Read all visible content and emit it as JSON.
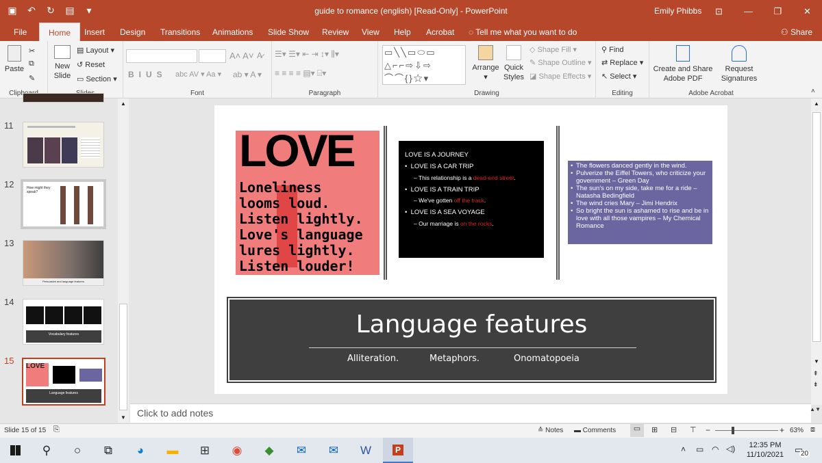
{
  "window": {
    "title": "guide to romance (english) [Read-Only]  -  PowerPoint",
    "user": "Emily Phibbs"
  },
  "tabs": [
    "File",
    "Home",
    "Insert",
    "Design",
    "Transitions",
    "Animations",
    "Slide Show",
    "Review",
    "View",
    "Help",
    "Acrobat"
  ],
  "tell_me": "Tell me what you want to do",
  "share": "Share",
  "ribbon": {
    "clipboard": {
      "paste": "Paste",
      "label": "Clipboard"
    },
    "slides": {
      "new_slide_1": "New",
      "new_slide_2": "Slide",
      "layout": "Layout",
      "reset": "Reset",
      "section": "Section",
      "label": "Slides"
    },
    "font": {
      "label": "Font"
    },
    "paragraph": {
      "label": "Paragraph"
    },
    "drawing": {
      "arrange": "Arrange",
      "quick_styles_1": "Quick",
      "quick_styles_2": "Styles",
      "shape_fill": "Shape Fill",
      "shape_outline": "Shape Outline",
      "shape_effects": "Shape Effects",
      "label": "Drawing"
    },
    "editing": {
      "find": "Find",
      "replace": "Replace",
      "select": "Select",
      "label": "Editing"
    },
    "acrobat": {
      "create_1": "Create and Share",
      "create_2": "Adobe PDF",
      "request_1": "Request",
      "request_2": "Signatures",
      "label": "Adobe Acrobat"
    }
  },
  "thumbnails": [
    {
      "num": "11"
    },
    {
      "num": "12"
    },
    {
      "num": "13"
    },
    {
      "num": "14"
    },
    {
      "num": "15"
    }
  ],
  "thumb_text": {
    "t12_q": "How might they speak?",
    "t13_caption": "Persuasive and language features",
    "t14_caption": "Vocabulary features",
    "t15_caption": "Language features"
  },
  "slide": {
    "love_title": "LOVE",
    "poem": [
      "Loneliness",
      "looms loud.",
      "Listen lightly.",
      "Love's language",
      "lures lightly.",
      "Listen louder!"
    ],
    "journey": {
      "heading": "LOVE IS A JOURNEY",
      "b1": "LOVE IS A CAR TRIP",
      "b1s_pre": "– This relationship is a ",
      "b1s_red": "dead-end street",
      "b1s_post": ".",
      "b2": "LOVE IS A TRAIN TRIP",
      "b2s_pre": "– We've gotten ",
      "b2s_red": "off the track",
      "b2s_post": ".",
      "b3": "LOVE IS A SEA VOYAGE",
      "b3s_pre": "– Our marriage is ",
      "b3s_red": "on the rocks",
      "b3s_post": "."
    },
    "quotes": [
      "The flowers danced gently in the wind.",
      "Pulverize the Eiffel Towers, who criticize your government – Green Day",
      "The sun's on my side, take me for a ride – Natasha Bedingfield",
      "The wind cries Mary – Jimi Hendrix",
      "So bright the sun is ashamed to rise and be in love with all those vampires – My Chemical Romance"
    ],
    "title": "Language features",
    "sub1": "Alliteration.",
    "sub2": "Metaphors.",
    "sub3": "Onomatopoeia"
  },
  "notes_placeholder": "Click to add notes",
  "status": {
    "slide": "Slide 15 of 15",
    "notes": "Notes",
    "comments": "Comments",
    "zoom": "63%"
  },
  "clock": {
    "time": "12:35 PM",
    "date": "11/10/2021",
    "notif": "20"
  },
  "colors": {
    "accent": "#b7472a",
    "love_bg": "#f07c7c",
    "quote_bg": "#6b66a0",
    "banner_bg": "#3f3f3f"
  }
}
